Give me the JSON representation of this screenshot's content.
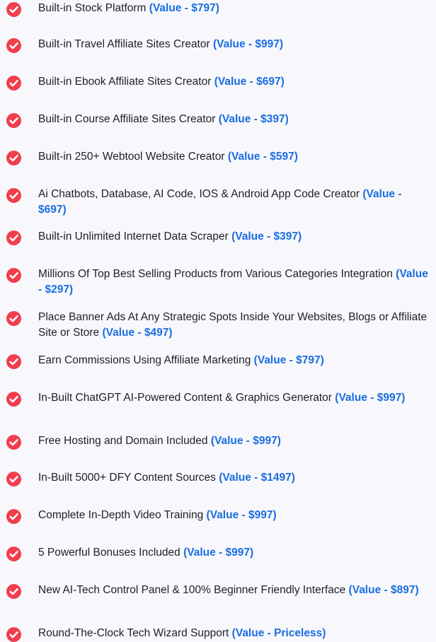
{
  "colors": {
    "check_icon": "#f03e4e",
    "value_text": "#1a6de0",
    "body_text": "#1e1e2a",
    "background": "#f8f8fc"
  },
  "icons": {
    "check": "check-circle-icon"
  },
  "features": [
    {
      "text": "Built-in Stock Platform",
      "value": "(Value - $797)"
    },
    {
      "text": "Built-in Travel Affiliate Sites Creator",
      "value": "(Value - $997)"
    },
    {
      "text": "Built-in Ebook Affiliate Sites Creator",
      "value": "(Value - $697)"
    },
    {
      "text": "Built-in Course Affiliate Sites Creator",
      "value": "(Value - $397)"
    },
    {
      "text": "Built-in 250+ Webtool Website Creator",
      "value": "(Value - $597)"
    },
    {
      "text": "Ai Chatbots, Database, AI Code, IOS & Android App Code Creator",
      "value": "(Value - $697)"
    },
    {
      "text": "Built-in Unlimited Internet Data Scraper",
      "value": "(Value - $397)"
    },
    {
      "text": "Millions Of Top Best Selling Products from Various Categories Integration",
      "value": "(Value - $297)"
    },
    {
      "text": "Place Banner Ads At Any Strategic Spots Inside Your Websites, Blogs or Affiliate Site or Store",
      "value": "(Value - $497)"
    },
    {
      "text": "Earn Commissions Using Affiliate Marketing",
      "value": "(Value - $797)"
    },
    {
      "text": "In-Built ChatGPT AI-Powered Content & Graphics Generator",
      "value": "(Value - $997)"
    },
    {
      "text": "Free Hosting and Domain Included",
      "value": "(Value - $997)"
    },
    {
      "text": "In-Built 5000+ DFY Content Sources",
      "value": "(Value - $1497)"
    },
    {
      "text": "Complete In-Depth Video Training",
      "value": "(Value - $997)"
    },
    {
      "text": "5 Powerful Bonuses Included",
      "value": "(Value - $997)"
    },
    {
      "text": "New AI-Tech Control Panel & 100% Beginner Friendly Interface",
      "value": "(Value - $897)"
    },
    {
      "text": "Round-The-Clock Tech Wizard Support",
      "value": "(Value - Priceless)"
    }
  ]
}
